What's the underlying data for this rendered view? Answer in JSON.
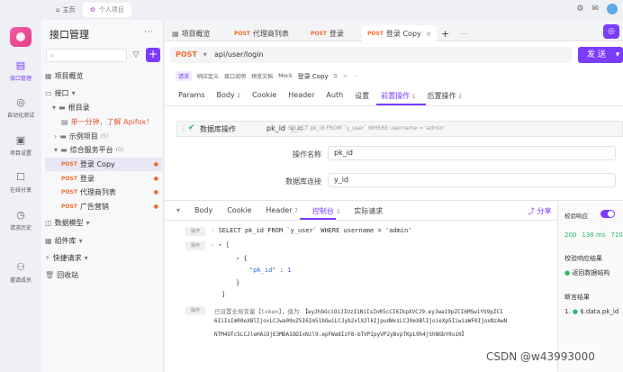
{
  "topbar": {
    "home": "主页",
    "project_tab": "个人项目"
  },
  "rail": [
    {
      "label": "接口管理",
      "icon": "api-icon"
    },
    {
      "label": "自动化测试",
      "icon": "auto-test-icon"
    },
    {
      "label": "项目设置",
      "icon": "project-settings-icon"
    },
    {
      "label": "在线分享",
      "icon": "share-icon"
    },
    {
      "label": "请求历史",
      "icon": "history-icon"
    },
    {
      "label": "邀请成员",
      "icon": "invite-icon"
    }
  ],
  "side": {
    "title": "接口管理",
    "items": [
      {
        "label": "项目概览"
      },
      {
        "label": "接口"
      },
      {
        "label": "根目录"
      },
      {
        "label": "单一分钟，了解 Apifox！"
      },
      {
        "label": "示例项目",
        "count": "(5)"
      },
      {
        "label": "综合服务平台",
        "count": "(0)"
      },
      {
        "method": "POST",
        "label": "登录 Copy"
      },
      {
        "method": "POST",
        "label": "登录"
      },
      {
        "method": "POST",
        "label": "代理商列表"
      },
      {
        "method": "POST",
        "label": "广告营销"
      },
      {
        "label": "数据模型"
      },
      {
        "label": "组件库"
      },
      {
        "label": "快捷请求"
      },
      {
        "label": "回收站"
      }
    ]
  },
  "tabs": [
    {
      "label": "项目概览"
    },
    {
      "method": "POST",
      "label": "代理商列表"
    },
    {
      "method": "POST",
      "label": "登录"
    },
    {
      "method": "POST",
      "label": "登录 Copy"
    }
  ],
  "request": {
    "method": "POST",
    "url": "api/user/login",
    "send": "发 送"
  },
  "subtabs": [
    "请求",
    "响应定义",
    "接口说明",
    "预览文档",
    "Mock",
    "登录 Copy"
  ],
  "reqtabs": [
    {
      "label": "Params"
    },
    {
      "label": "Body",
      "n": "2"
    },
    {
      "label": "Cookie"
    },
    {
      "label": "Header"
    },
    {
      "label": "Auth"
    },
    {
      "label": "设置"
    },
    {
      "label": "前置操作",
      "n": "1"
    },
    {
      "label": "后置操作",
      "n": "2"
    }
  ],
  "operation": {
    "name": "数据库操作",
    "code": "pk_id",
    "alias": "y_id",
    "sql": "SELECT pk_id FROM `y_user` WHERE username = 'admin'",
    "name_label": "操作名称",
    "name_value": "pk_id",
    "conn_label": "数据库连接",
    "conn_value": "y_id"
  },
  "bottom_tabs": [
    {
      "label": "Body"
    },
    {
      "label": "Cookie"
    },
    {
      "label": "Header",
      "n": "7"
    },
    {
      "label": "控制台",
      "n": "3"
    },
    {
      "label": "实际请求"
    }
  ],
  "share": "分享",
  "console": {
    "badge": "操作",
    "sql": "SELECT pk_id FROM `y_user` WHERE username = 'admin'",
    "key": "\"pk_id\"",
    "val": "1",
    "token_prefix": "已设置全局变量【token】，值为",
    "token_l1": "【eyJhbGciOiJIUzI1NiIsInR5cCI6IkpXVCJ9.eyJwa19pZCI6MSwiYV9pZCI",
    "token_l2": "6IiIsImR0eXBlIjoxLCJwa09uZSI6Im51bGwiLCJyb2xlX2lkIjpudWxsLCJ0eXBlIjoieXp5IiwiaWF0IjoxNzAwN",
    "token_l3": "NTM4OTc5LCJleHAiOjE3MDA1ODIxNzl9.epFWa8IzF8-bTVPIpyVP2yBvpTKpL9h4jShNGbY0u10】"
  },
  "rightpanel": {
    "verify": "校验响应",
    "status": "200",
    "time": "138 ms",
    "size": "710",
    "result_title": "校验响应结果",
    "result": "返回数据结构",
    "assert_title": "断言结果",
    "assert": "1. ",
    "assert_expr": "$.data.pk_id"
  },
  "watermark": "CSDN @w43993000",
  "colors": {
    "accent": "#7a3cff",
    "post": "#f06b2a",
    "ok": "#27b765"
  }
}
